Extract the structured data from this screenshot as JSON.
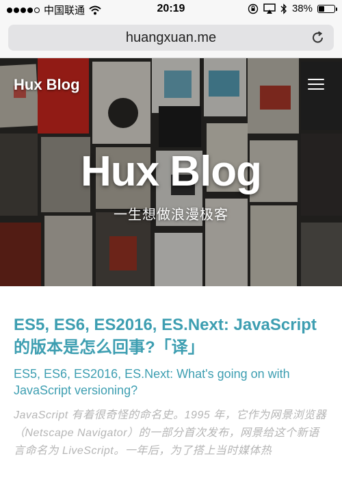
{
  "status_bar": {
    "signal_dots": "●●●●○",
    "carrier": "中国联通",
    "time": "20:19",
    "battery_percent_text": "38%",
    "battery_level": 0.38
  },
  "browser": {
    "url": "huangxuan.me"
  },
  "nav": {
    "brand": "Hux Blog"
  },
  "hero": {
    "title": "Hux Blog",
    "subtitle": "一生想做浪漫极客"
  },
  "post": {
    "title": "ES5, ES6, ES2016, ES.Next: JavaScript 的版本是怎么回事?「译」",
    "subtitle": "ES5, ES6, ES2016, ES.Next: What's going on with JavaScript versioning?",
    "excerpt": "JavaScript 有着很奇怪的命名史。1995 年，它作为网景浏览器（Netscape Navigator）的一部分首次发布，网景给这个新语言命名为 LiveScript。一年后，为了搭上当时媒体热"
  },
  "colors": {
    "accent": "#3d9eb1",
    "excerpt": "#b5b5b5",
    "chrome": "#f7f7f7"
  },
  "icons": [
    "wifi-icon",
    "orientation-lock-icon",
    "airplay-icon",
    "bluetooth-icon",
    "battery-icon",
    "reload-icon",
    "hamburger-menu-icon"
  ]
}
